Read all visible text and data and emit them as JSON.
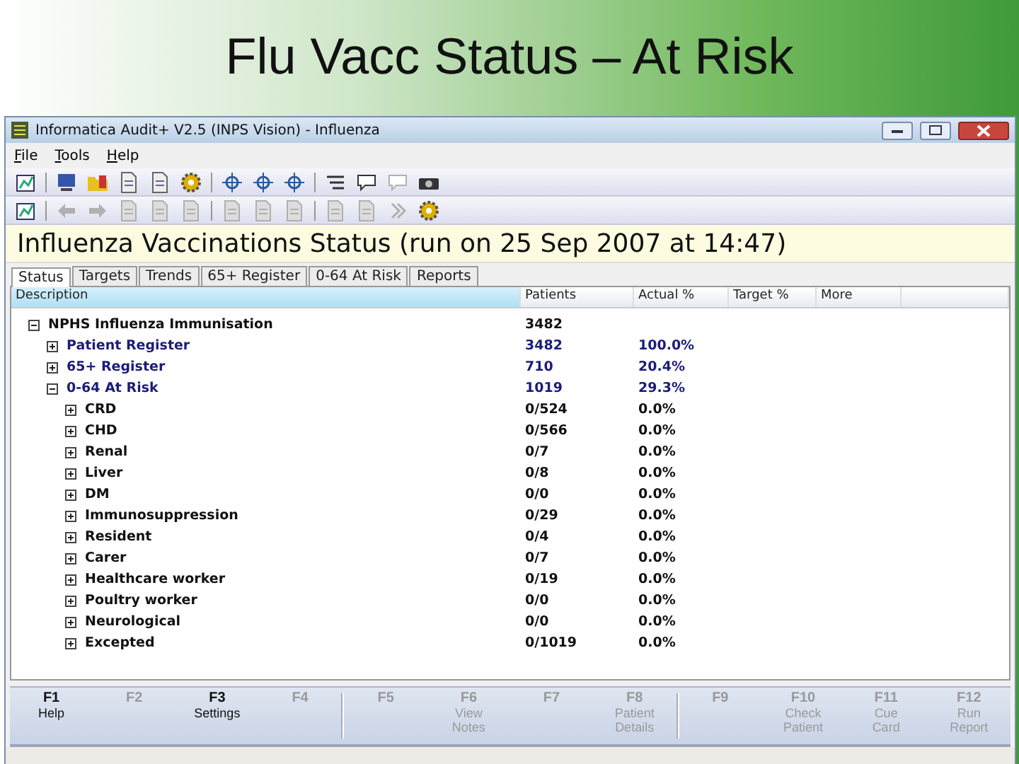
{
  "slide": {
    "title": "Flu Vacc Status – At Risk"
  },
  "window": {
    "title": "Informatica Audit+ V2.5 (INPS Vision) - Influenza"
  },
  "menu": [
    "File",
    "Tools",
    "Help"
  ],
  "toolbars": [
    [
      {
        "kind": "chart",
        "disabled": false
      },
      {
        "kind": "separator"
      },
      {
        "kind": "monitor",
        "disabled": false
      },
      {
        "kind": "folder",
        "disabled": false
      },
      {
        "kind": "document",
        "disabled": false
      },
      {
        "kind": "document",
        "disabled": false
      },
      {
        "kind": "gear",
        "disabled": false
      },
      {
        "kind": "separator"
      },
      {
        "kind": "crosshair",
        "disabled": false
      },
      {
        "kind": "crosshair",
        "disabled": false
      },
      {
        "kind": "crosshair",
        "disabled": false
      },
      {
        "kind": "separator"
      },
      {
        "kind": "list",
        "disabled": false
      },
      {
        "kind": "speech",
        "disabled": false
      },
      {
        "kind": "speech",
        "disabled": true
      },
      {
        "kind": "camera",
        "disabled": false
      }
    ],
    [
      {
        "kind": "chart",
        "disabled": false
      },
      {
        "kind": "separator"
      },
      {
        "kind": "arrow-left",
        "disabled": true
      },
      {
        "kind": "arrow-right",
        "disabled": true
      },
      {
        "kind": "document",
        "disabled": true
      },
      {
        "kind": "document",
        "disabled": true
      },
      {
        "kind": "document",
        "disabled": true
      },
      {
        "kind": "separator"
      },
      {
        "kind": "document",
        "disabled": true
      },
      {
        "kind": "document",
        "disabled": true
      },
      {
        "kind": "document",
        "disabled": true
      },
      {
        "kind": "separator"
      },
      {
        "kind": "document",
        "disabled": true
      },
      {
        "kind": "document",
        "disabled": true
      },
      {
        "kind": "chevron",
        "disabled": true
      },
      {
        "kind": "gear",
        "disabled": false
      }
    ]
  ],
  "banner": "Influenza Vaccinations Status (run on 25 Sep 2007 at 14:47)",
  "tabs": [
    {
      "label": "Status",
      "selected": true
    },
    {
      "label": "Targets",
      "selected": false
    },
    {
      "label": "Trends",
      "selected": false
    },
    {
      "label": "65+ Register",
      "selected": false
    },
    {
      "label": "0-64 At Risk",
      "selected": false
    },
    {
      "label": "Reports",
      "selected": false
    }
  ],
  "table": {
    "columns": [
      "Description",
      "Patients",
      "Actual %",
      "Target %",
      "More"
    ],
    "tree": [
      {
        "label": "NPHS Influenza Immunisation",
        "patients": "3482",
        "expanded": true,
        "children": [
          {
            "label": "Patient Register",
            "patients": "3482",
            "actual": "100.0%",
            "expanded": false
          },
          {
            "label": "65+ Register",
            "patients": "710",
            "actual": "20.4%",
            "expanded": false
          },
          {
            "label": "0-64 At Risk",
            "patients": "1019",
            "actual": "29.3%",
            "expanded": true,
            "children": [
              {
                "label": "CRD",
                "patients": "0/524",
                "actual": "0.0%",
                "expanded": false
              },
              {
                "label": "CHD",
                "patients": "0/566",
                "actual": "0.0%",
                "expanded": false
              },
              {
                "label": "Renal",
                "patients": "0/7",
                "actual": "0.0%",
                "expanded": false
              },
              {
                "label": "Liver",
                "patients": "0/8",
                "actual": "0.0%",
                "expanded": false
              },
              {
                "label": "DM",
                "patients": "0/0",
                "actual": "0.0%",
                "expanded": false
              },
              {
                "label": "Immunosuppression",
                "patients": "0/29",
                "actual": "0.0%",
                "expanded": false
              },
              {
                "label": "Resident",
                "patients": "0/4",
                "actual": "0.0%",
                "expanded": false
              },
              {
                "label": "Carer",
                "patients": "0/7",
                "actual": "0.0%",
                "expanded": false
              },
              {
                "label": "Healthcare worker",
                "patients": "0/19",
                "actual": "0.0%",
                "expanded": false
              },
              {
                "label": "Poultry worker",
                "patients": "0/0",
                "actual": "0.0%",
                "expanded": false
              },
              {
                "label": "Neurological",
                "patients": "0/0",
                "actual": "0.0%",
                "expanded": false
              },
              {
                "label": "Excepted",
                "patients": "0/1019",
                "actual": "0.0%",
                "expanded": false
              }
            ]
          }
        ]
      }
    ]
  },
  "function_keys": [
    {
      "key": "F1",
      "label": "Help",
      "disabled": false
    },
    {
      "key": "F2",
      "disabled": true
    },
    {
      "key": "F3",
      "label": "Settings",
      "disabled": false
    },
    {
      "key": "F4",
      "disabled": true
    },
    {
      "key": "F5",
      "disabled": true
    },
    {
      "key": "F6",
      "label": "View Notes",
      "disabled": true
    },
    {
      "key": "F7",
      "disabled": true
    },
    {
      "key": "F8",
      "label": "Patient Details",
      "disabled": true
    },
    {
      "key": "F9",
      "disabled": true
    },
    {
      "key": "F10",
      "label": "Check Patient",
      "disabled": true
    },
    {
      "key": "F11",
      "label": "Cue Card",
      "disabled": true
    },
    {
      "key": "F12",
      "label": "Run Report",
      "disabled": true
    }
  ]
}
